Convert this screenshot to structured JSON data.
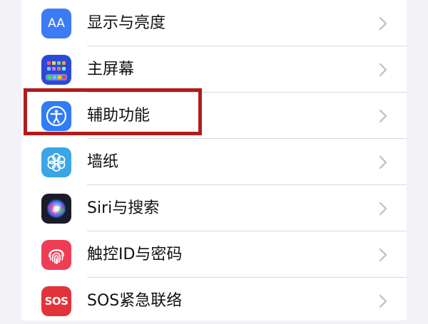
{
  "settings": {
    "items": [
      {
        "label": "显示与亮度",
        "icon": "display-brightness-icon",
        "color": "#3b7cf5"
      },
      {
        "label": "主屏幕",
        "icon": "home-screen-icon",
        "color": "#2b48d6"
      },
      {
        "label": "辅助功能",
        "icon": "accessibility-icon",
        "color": "#2f7cf6"
      },
      {
        "label": "墙纸",
        "icon": "wallpaper-icon",
        "color": "#3aa6e5"
      },
      {
        "label": "Siri与搜索",
        "icon": "siri-icon",
        "color": "#1b1b2a"
      },
      {
        "label": "触控ID与密码",
        "icon": "touch-id-icon",
        "color": "#ef3d55"
      },
      {
        "label": "SOS紧急联络",
        "icon": "sos-icon",
        "color": "#e2333a"
      }
    ],
    "icon_text": {
      "display": "AA",
      "sos": "SOS"
    }
  },
  "highlight": {
    "target": "辅助功能",
    "color": "#b31b1b"
  }
}
